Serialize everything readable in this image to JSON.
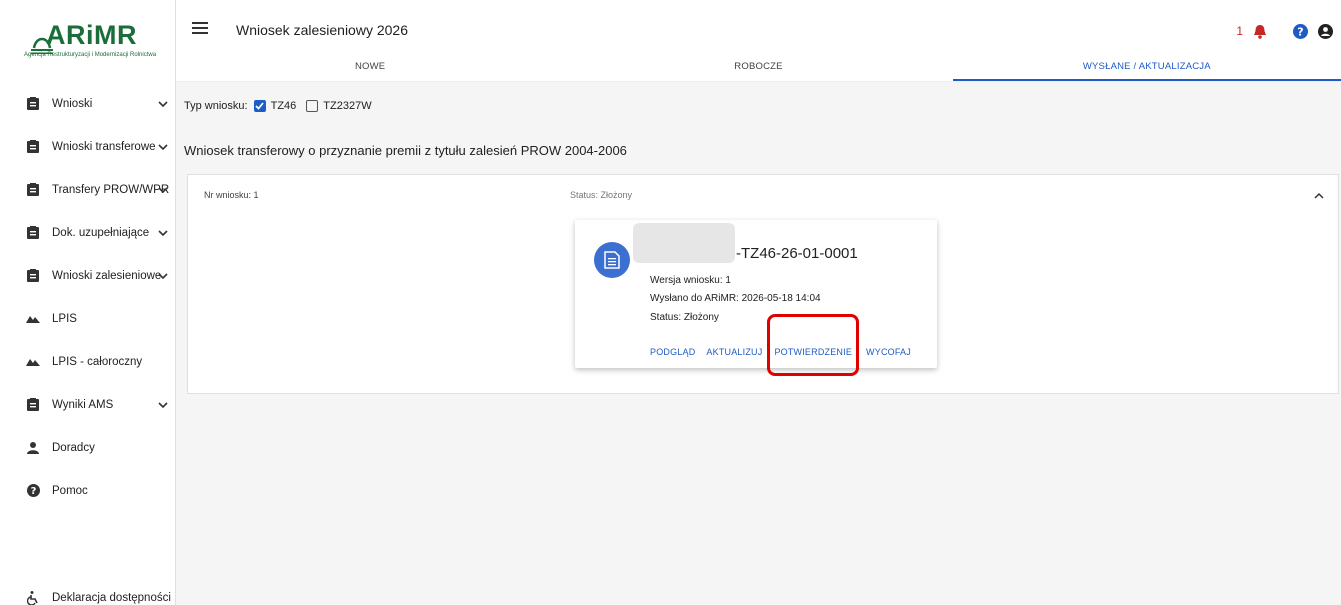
{
  "logo": {
    "name_lead": "AR",
    "name_tail": "iMR",
    "subtitle": "Agencja Restrukturyzacji i Modernizacji Rolnictwa",
    "color": "#1b6e3a"
  },
  "sidebar": {
    "items": [
      {
        "label": "Wnioski",
        "icon": "clipboard-icon",
        "chevron": true
      },
      {
        "label": "Wnioski transferowe",
        "icon": "clipboard-icon",
        "chevron": true
      },
      {
        "label": "Transfery PROW/WPR",
        "icon": "clipboard-icon",
        "chevron": true
      },
      {
        "label": "Dok. uzupełniające",
        "icon": "clipboard-icon",
        "chevron": true
      },
      {
        "label": "Wnioski zalesieniowe",
        "icon": "clipboard-icon",
        "chevron": true
      },
      {
        "label": "LPIS",
        "icon": "landscape-icon",
        "chevron": false
      },
      {
        "label": "LPIS - całoroczny",
        "icon": "landscape-icon",
        "chevron": false
      },
      {
        "label": "Wyniki AMS",
        "icon": "clipboard-icon",
        "chevron": true
      },
      {
        "label": "Doradcy",
        "icon": "person-icon",
        "chevron": false
      },
      {
        "label": "Pomoc",
        "icon": "help-icon",
        "chevron": false
      }
    ],
    "declaration": "Deklaracja dostępności"
  },
  "header": {
    "title": "Wniosek zalesieniowy 2026",
    "notification_count": "1",
    "tabs": [
      {
        "label": "NOWE",
        "active": false
      },
      {
        "label": "ROBOCZE",
        "active": false
      },
      {
        "label": "WYSŁANE / AKTUALIZACJA",
        "active": true
      }
    ]
  },
  "filter": {
    "label": "Typ wniosku:",
    "options": [
      {
        "label": "TZ46",
        "checked": true
      },
      {
        "label": "TZ2327W",
        "checked": false
      }
    ]
  },
  "section": {
    "title": "Wniosek transferowy o przyznanie premii z tytułu zalesień PROW 2004-2006"
  },
  "panel": {
    "number": "Nr wniosku: 1",
    "status": "Status: Złożony"
  },
  "card": {
    "title": "-TZ46-26-01-0001",
    "version": "Wersja wniosku: 1",
    "sent": "Wysłano do ARiMR: 2026-05-18 14:04",
    "status": "Status: Złożony",
    "actions": [
      "PODGLĄD",
      "AKTUALIZUJ",
      "POTWIERDZENIE",
      "WYCOFAJ"
    ]
  },
  "colors": {
    "accent": "#1e5bc6",
    "highlight": "#e00000",
    "alert": "#c62828"
  }
}
